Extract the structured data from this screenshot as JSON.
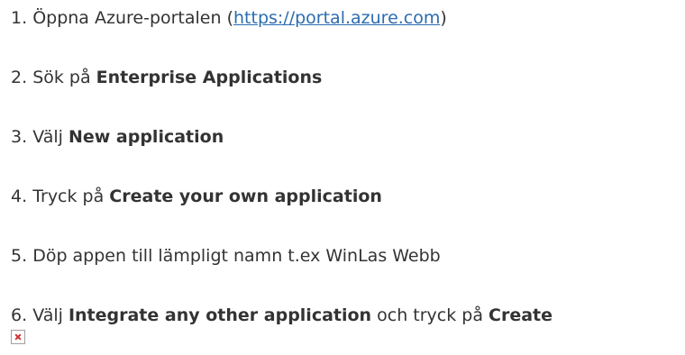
{
  "steps": [
    {
      "number": "1.",
      "prefix": "Öppna Azure-portalen (",
      "link": "https://portal.azure.com",
      "suffix": ")"
    },
    {
      "number": "2.",
      "prefix": "Sök på ",
      "bold": "Enterprise Applications"
    },
    {
      "number": "3.",
      "prefix": "Välj ",
      "bold": "New application"
    },
    {
      "number": "4.",
      "prefix": "Tryck på ",
      "bold": "Create your own application"
    },
    {
      "number": "5.",
      "text": "Döp appen till lämpligt namn t.ex WinLas Webb"
    },
    {
      "number": "6.",
      "prefix": "Välj ",
      "bold": "Integrate any other application",
      "middle": " och tryck på ",
      "bold2": "Create"
    }
  ],
  "broken_image_icon": "broken-image-icon",
  "colors": {
    "text": "#333333",
    "link": "#2b6cb0",
    "broken_image_x": "#d32f2f"
  }
}
